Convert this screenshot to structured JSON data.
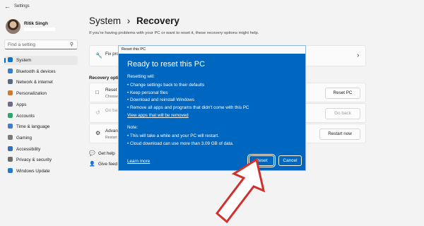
{
  "window": {
    "app_title": "Settings",
    "back": "←"
  },
  "user": {
    "name": "Ritik Singh"
  },
  "search": {
    "placeholder": "Find a setting",
    "icon": "search-icon"
  },
  "sidebar": {
    "items": [
      {
        "label": "System",
        "active": true,
        "icon_color": "#0078d4"
      },
      {
        "label": "Bluetooth & devices",
        "icon_color": "#2e7fd6"
      },
      {
        "label": "Network & internet",
        "icon_color": "#5a6b80"
      },
      {
        "label": "Personalization",
        "icon_color": "#d07a2e"
      },
      {
        "label": "Apps",
        "icon_color": "#6c6c8a"
      },
      {
        "label": "Accounts",
        "icon_color": "#2ea66b"
      },
      {
        "label": "Time & language",
        "icon_color": "#3b7dd8"
      },
      {
        "label": "Gaming",
        "icon_color": "#7a7a7a"
      },
      {
        "label": "Accessibility",
        "icon_color": "#2f6fc4"
      },
      {
        "label": "Privacy & security",
        "icon_color": "#6d6d6d"
      },
      {
        "label": "Windows Update",
        "icon_color": "#1e7ad6"
      }
    ]
  },
  "header": {
    "breadcrumb_parent": "System",
    "separator": "›",
    "title": "Recovery",
    "subtitle": "If you're having problems with your PC or want to reset it, these recovery options might help."
  },
  "fix_card": {
    "title": "Fix pro",
    "chevron": "›"
  },
  "recovery_options": {
    "label": "Recovery optio",
    "items": [
      {
        "title": "Reset t",
        "sub": "Choose",
        "button": "Reset PC"
      },
      {
        "title": "Go ba",
        "sub": "",
        "button": "Go back"
      },
      {
        "title": "Advan",
        "sub": "Restart",
        "button": "Restart now"
      }
    ]
  },
  "help_links": {
    "get_help": "Get help",
    "feedback": "Give feed"
  },
  "dialog": {
    "window_title": "Reset this PC",
    "heading": "Ready to reset this PC",
    "resetting_label": "Resetting will:",
    "bullets": [
      "Change settings back to their defaults",
      "Keep personal files",
      "Download and reinstall Windows",
      "Remove all apps and programs that didn't come with this PC"
    ],
    "view_apps_link": "View apps that will be removed",
    "note_label": "Note:",
    "notes": [
      "This will take a while and your PC will restart.",
      "Cloud download can use more than 3.09 GB of data."
    ],
    "learn_more": "Learn more",
    "reset_button": "Reset",
    "cancel_button": "Cancel"
  },
  "annotation": {
    "color": "#d0312d"
  }
}
